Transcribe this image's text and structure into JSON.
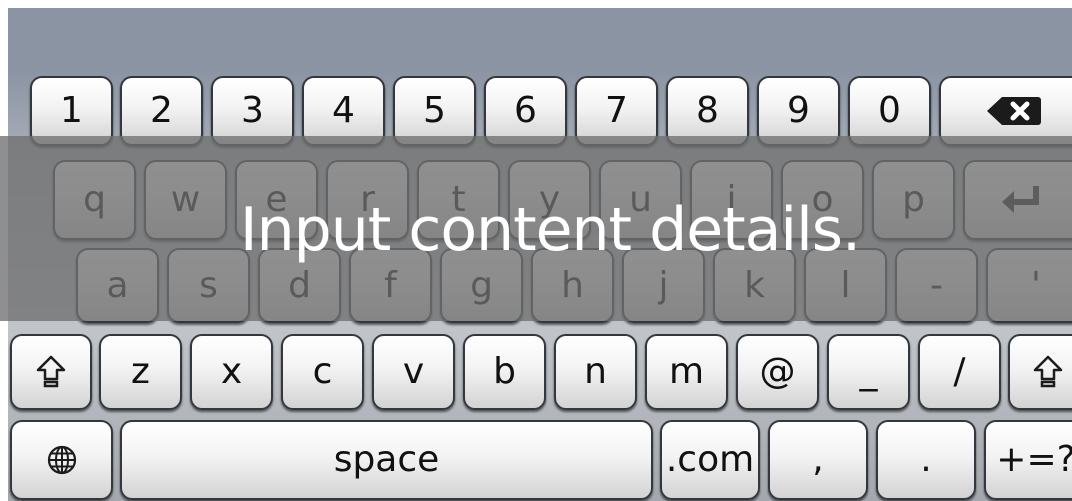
{
  "keyboard": {
    "row1": [
      "1",
      "2",
      "3",
      "4",
      "5",
      "6",
      "7",
      "8",
      "9",
      "0"
    ],
    "backspace_icon": "backspace-icon",
    "row2": [
      "q",
      "w",
      "e",
      "r",
      "t",
      "y",
      "u",
      "i",
      "o",
      "p"
    ],
    "enter_icon": "enter-icon",
    "row3": [
      "a",
      "s",
      "d",
      "f",
      "g",
      "h",
      "j",
      "k",
      "l",
      "-",
      "'"
    ],
    "row4": [
      "z",
      "x",
      "c",
      "v",
      "b",
      "n",
      "m",
      "@",
      "_",
      "/"
    ],
    "shift_icon": "shift-icon",
    "row5": {
      "globe_icon": "globe-icon",
      "space": "space",
      "dotcom": ".com",
      "comma": ",",
      "period": ".",
      "symbols": "+=?"
    }
  },
  "overlay": {
    "message": "Input content details."
  }
}
